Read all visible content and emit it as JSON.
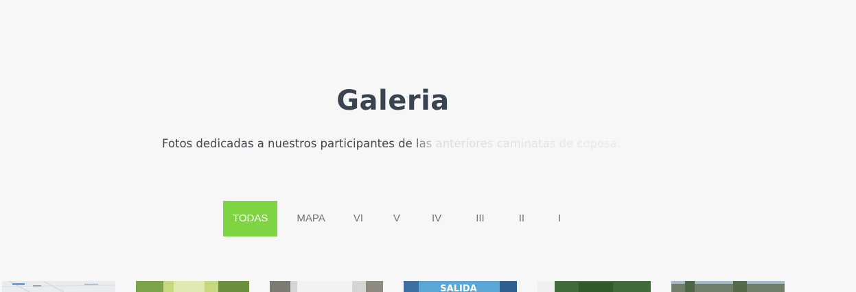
{
  "header": {
    "title": "Galeria",
    "subtitle": "Fotos dedicadas a nuestros participantes de las anteriores caminatas de coposa."
  },
  "filters": [
    {
      "label": "TODAS",
      "active": true
    },
    {
      "label": "MAPA",
      "active": false
    },
    {
      "label": "VI",
      "active": false
    },
    {
      "label": "V",
      "active": false
    },
    {
      "label": "IV",
      "active": false
    },
    {
      "label": "III",
      "active": false
    },
    {
      "label": "II",
      "active": false
    },
    {
      "label": "I",
      "active": false
    }
  ],
  "colors": {
    "accent": "#7ed443",
    "background": "#f7f7f7",
    "title": "#3a4350"
  },
  "gallery": {
    "thumbnails": [
      {
        "subject": "map"
      },
      {
        "subject": "green-photo"
      },
      {
        "subject": "street-photo"
      },
      {
        "subject": "banner-photo",
        "text": "SALIDA"
      },
      {
        "subject": "trees-photo"
      },
      {
        "subject": "palms-photo"
      }
    ]
  }
}
